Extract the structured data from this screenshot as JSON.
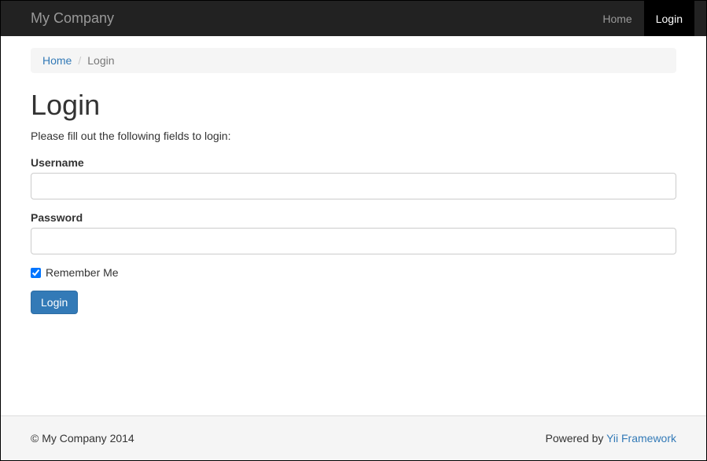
{
  "navbar": {
    "brand": "My Company",
    "items": [
      {
        "label": "Home",
        "active": false
      },
      {
        "label": "Login",
        "active": true
      }
    ]
  },
  "breadcrumb": {
    "items": [
      {
        "label": "Home",
        "link": true
      },
      {
        "label": "Login",
        "link": false
      }
    ]
  },
  "page": {
    "title": "Login",
    "hint": "Please fill out the following fields to login:"
  },
  "form": {
    "username_label": "Username",
    "username_value": "",
    "password_label": "Password",
    "password_value": "",
    "remember_label": "Remember Me",
    "remember_checked": true,
    "submit_label": "Login"
  },
  "footer": {
    "copyright": "© My Company 2014",
    "powered_prefix": "Powered by ",
    "powered_link": "Yii Framework"
  }
}
